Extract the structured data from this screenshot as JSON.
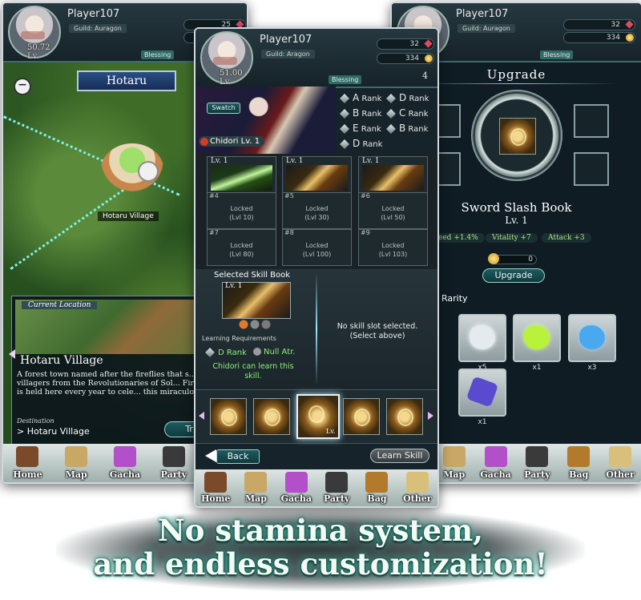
{
  "left_screen": {
    "player_name": "Player107",
    "guild": "Guild: Auragon",
    "level": "50.72",
    "level_unit": "Lv",
    "stamina_value": "25",
    "gems_value": "",
    "blessing_label": "Blessing",
    "region_title": "Hotaru",
    "map_marker": "Hotaru Village",
    "location_badge": "Current Location",
    "location_name": "Hotaru Village",
    "description": "A forest town named after the fireflies that s... the villagers from the Revolutionaries of Sol... Firefly Festival is held here every year to cele... this miraculous event.",
    "destination_label": "Destination",
    "destination_value": "Hotaru Village",
    "travel_button": "Tr"
  },
  "center_screen": {
    "player_name": "Player107",
    "guild": "Guild: Aragon",
    "level": "51.00",
    "level_unit": "Lv",
    "stamina_value": "32",
    "gold_value": "334",
    "blessing_label": "Blessing",
    "blessing_value": "4",
    "swatch_button": "Swatch",
    "character_name": "Chidori Lv. 1",
    "ranks": [
      {
        "letter": "A",
        "label": "Rank"
      },
      {
        "letter": "D",
        "label": "Rank"
      },
      {
        "letter": "B",
        "label": "Rank"
      },
      {
        "letter": "C",
        "label": "Rank"
      },
      {
        "letter": "E",
        "label": "Rank"
      },
      {
        "letter": "B",
        "label": "Rank"
      },
      {
        "letter": "D",
        "label": "Rank"
      }
    ],
    "skill_slots": [
      {
        "label": "Lv. 1",
        "state": "unlocked",
        "style": "green"
      },
      {
        "label": "Lv. 1",
        "state": "unlocked",
        "style": "gold"
      },
      {
        "label": "Lv. 1",
        "state": "unlocked",
        "style": "gold"
      },
      {
        "num": "#4",
        "locked": "Locked",
        "req": "(Lvl 10)"
      },
      {
        "num": "#5",
        "locked": "Locked",
        "req": "(Lvl 30)"
      },
      {
        "num": "#6",
        "locked": "Locked",
        "req": "(Lvl 50)"
      },
      {
        "num": "#7",
        "locked": "Locked",
        "req": "(Lvl 80)"
      },
      {
        "num": "#8",
        "locked": "Locked",
        "req": "(Lvl 100)"
      },
      {
        "num": "#9",
        "locked": "Locked",
        "req": "(Lvl 103)"
      }
    ],
    "selected_header": "Selected Skill Book",
    "selected_level": "Lv. 1",
    "learning_requirements": "Learning Requirements",
    "req_rank": "D Rank",
    "req_attr": "Null Atr.",
    "can_learn": "Chidori can learn this skill.",
    "no_slot": "No skill slot selected. (Select above)",
    "book_level": "Lv.",
    "back_button": "Back",
    "learn_button": "Learn Skill"
  },
  "right_screen": {
    "player_name": "Player107",
    "guild": "Guild: Auragon",
    "stamina_value": "32",
    "gold_value": "334",
    "blessing_label": "Blessing",
    "title": "Upgrade",
    "item_name": "Sword Slash Book",
    "item_level": "Lv. 1",
    "stats": [
      "eed +1.4%",
      "Vitality +7",
      "Attack +3"
    ],
    "cost_value": "0",
    "upgrade_button": "Upgrade",
    "rarity_label": "Rarity",
    "materials": [
      {
        "count": "x5",
        "color": "#d8dde0"
      },
      {
        "count": "x1",
        "color": "#b8f23a"
      },
      {
        "count": "x3",
        "color": "#4aa8ef"
      },
      {
        "count": "x1",
        "color": "#5a4ad0"
      }
    ]
  },
  "nav": {
    "items": [
      "Home",
      "Map",
      "Gacha",
      "Party",
      "Bag",
      "Other"
    ]
  },
  "tagline": {
    "line1": "No stamina system,",
    "line2": "and endless customization!"
  }
}
